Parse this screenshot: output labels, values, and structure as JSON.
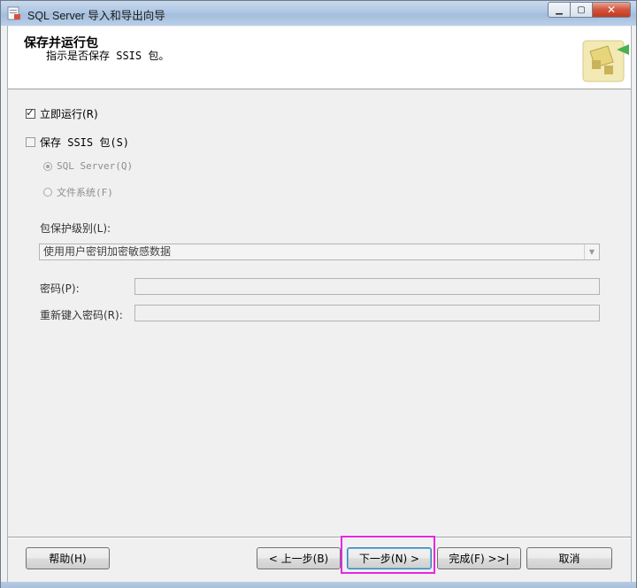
{
  "window": {
    "title": "SQL Server 导入和导出向导",
    "controls": {
      "minimize": "minimize-icon",
      "maximize": "maximize-icon",
      "close": "close-icon"
    }
  },
  "header": {
    "title": "保存并运行包",
    "subtitle": "指示是否保存 SSIS 包。"
  },
  "options": {
    "run_now": {
      "label": "立即运行(R)",
      "checked": true
    },
    "save_ssis": {
      "label": "保存 SSIS 包(S)",
      "checked": false
    },
    "sql_server": {
      "label": "SQL Server(Q)",
      "selected": true,
      "enabled": false
    },
    "file_system": {
      "label": "文件系统(F)",
      "selected": false,
      "enabled": false
    }
  },
  "protection": {
    "label": "包保护级别(L):",
    "selected": "使用用户密钥加密敏感数据"
  },
  "password": {
    "label": "密码(P):",
    "value": ""
  },
  "reenter_password": {
    "label": "重新键入密码(R):",
    "value": ""
  },
  "buttons": {
    "help": "帮助(H)",
    "back": "< 上一步(B)",
    "next": "下一步(N) >",
    "finish": "完成(F) >>|",
    "cancel": "取消"
  },
  "colors": {
    "highlight": "#e528e0",
    "window_frame": "#aec6e3"
  }
}
